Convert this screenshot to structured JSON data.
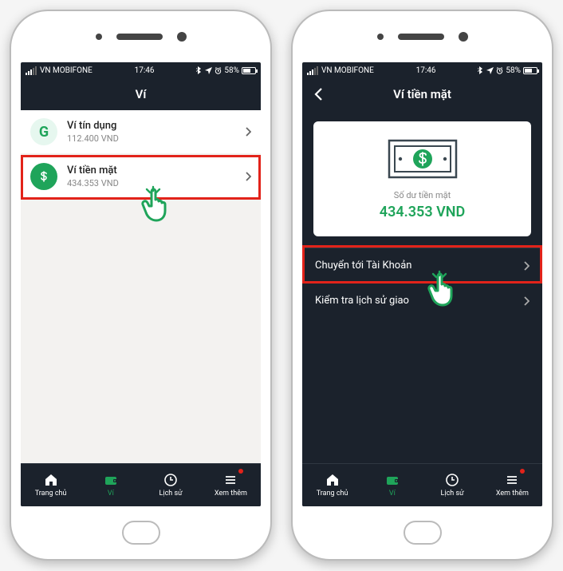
{
  "status": {
    "carrier": "VN MOBIFONE",
    "time": "17:46",
    "battery_pct": "58%"
  },
  "screen1": {
    "title": "Ví",
    "wallets": [
      {
        "name": "Ví tín dụng",
        "amount": "112.400 VND",
        "icon": "g-letter",
        "color_bg": "#e6f7ef",
        "color_fg": "#1fa45a"
      },
      {
        "name": "Ví tiền mặt",
        "amount": "434.353 VND",
        "icon": "dollar",
        "color_bg": "#1fa45a",
        "color_fg": "#ffffff"
      }
    ]
  },
  "screen2": {
    "title": "Ví tiền mặt",
    "balance_label": "Số dư tiền mặt",
    "balance_amount": "434.353 VND",
    "actions": [
      {
        "label": "Chuyển tới Tài Khoản"
      },
      {
        "label": "Kiểm tra lịch sử giao"
      }
    ]
  },
  "tabs": [
    {
      "label": "Trang chủ",
      "icon": "home"
    },
    {
      "label": "Ví",
      "icon": "wallet",
      "active": true
    },
    {
      "label": "Lịch sử",
      "icon": "clock"
    },
    {
      "label": "Xem thêm",
      "icon": "menu",
      "badge": true
    }
  ],
  "colors": {
    "accent": "#1fa45a",
    "danger": "#e2231a"
  }
}
